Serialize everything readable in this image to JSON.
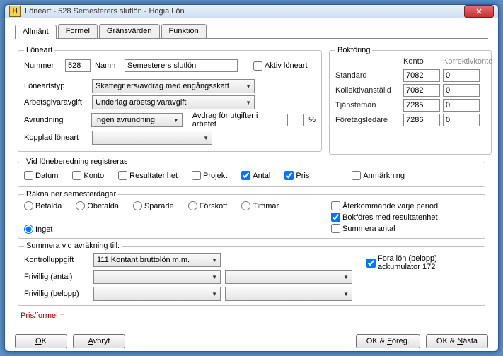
{
  "window": {
    "title": "Löneart - 528 Semesterers slutlön - Hogia Lön",
    "icon_letter": "H"
  },
  "tabs": [
    "Allmänt",
    "Formel",
    "Gränsvärden",
    "Funktion"
  ],
  "active_tab": 0,
  "loneart": {
    "legend": "Löneart",
    "nummer_label": "Nummer",
    "nummer": "528",
    "namn_label": "Namn",
    "namn": "Semesterers slutlön",
    "aktiv_label": "Aktiv löneart",
    "aktiv": false,
    "loneartstyp_label": "Löneartstyp",
    "loneartstyp": "Skattegr ers/avdrag med engångsskatt",
    "arbetsgivaravgift_label": "Arbetsgivaravgift",
    "arbetsgivaravgift": "Underlag arbetsgivaravgift",
    "avrundning_label": "Avrundning",
    "avrundning": "Ingen avrundning",
    "avdrag_label": "Avdrag för utgifter i arbetet",
    "avdrag_pct": "",
    "kopplad_label": "Kopplad löneart",
    "kopplad": ""
  },
  "bokforing": {
    "legend": "Bokföring",
    "konto_hdr": "Konto",
    "korrektiv_hdr": "Korrektivkonto",
    "rows": [
      {
        "label": "Standard",
        "konto": "7082",
        "korr": "0"
      },
      {
        "label": "Kollektivanställd",
        "konto": "7082",
        "korr": "0"
      },
      {
        "label": "Tjänsteman",
        "konto": "7285",
        "korr": "0"
      },
      {
        "label": "Företagsledare",
        "konto": "7286",
        "korr": "0"
      }
    ]
  },
  "registreras": {
    "legend": "Vid löneberedning registreras",
    "items": [
      {
        "label": "Datum",
        "checked": false
      },
      {
        "label": "Konto",
        "checked": false
      },
      {
        "label": "Resultatenhet",
        "checked": false
      },
      {
        "label": "Projekt",
        "checked": false
      },
      {
        "label": "Antal",
        "checked": true
      },
      {
        "label": "Pris",
        "checked": true
      },
      {
        "label": "Anmärkning",
        "checked": false
      }
    ]
  },
  "semester": {
    "legend": "Räkna ner semesterdagar",
    "options": [
      "Betalda",
      "Obetalda",
      "Sparade",
      "Förskott",
      "Timmar",
      "Inget"
    ],
    "selected": 5,
    "side_checks": [
      {
        "label": "Återkommande varje period",
        "checked": false
      },
      {
        "label": "Bokföres med resultatenhet",
        "checked": true
      },
      {
        "label": "Summera antal",
        "checked": false
      }
    ]
  },
  "summera": {
    "legend": "Summera vid avräkning till:",
    "kontroll_label": "Kontrolluppgift",
    "kontroll": "111 Kontant bruttolön m.m.",
    "frivillig_antal_label": "Frivillig (antal)",
    "frivillig_antal_a": "",
    "frivillig_antal_b": "",
    "frivillig_belopp_label": "Frivillig (belopp)",
    "frivillig_belopp_a": "",
    "frivillig_belopp_b": "",
    "fora_label": "Fora lön (belopp) ackumulator 172",
    "fora_checked": true
  },
  "pris_formel": "Pris/formel =",
  "buttons": {
    "ok": "OK",
    "avbryt": "Avbryt",
    "ok_foreg": "OK & Föreg.",
    "ok_nasta": "OK & Nästa"
  }
}
